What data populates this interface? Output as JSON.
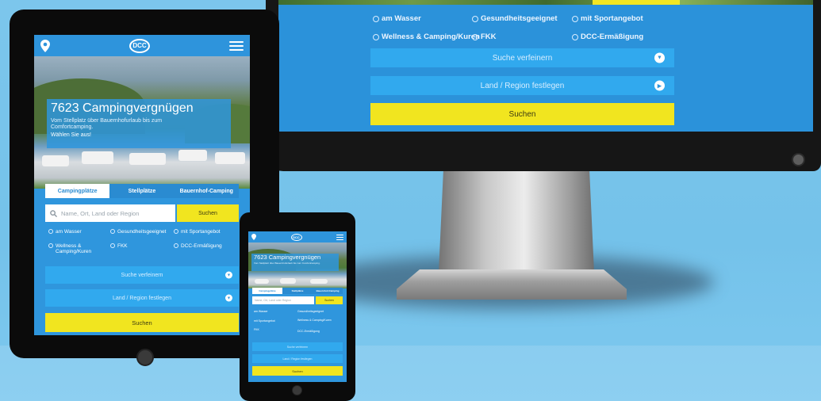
{
  "brand": {
    "logo_text": "DCC"
  },
  "hero": {
    "title": "7623 Campingvergnügen",
    "subtitle": "Vom Stellplatz über Bauernhofurlaub bis zum Comfortcamping.",
    "cta": "Wählen Sie aus!"
  },
  "tabs": [
    "Campingplätze",
    "Stellplätze",
    "Bauernhof-Camping"
  ],
  "search": {
    "placeholder": "Name, Ort, Land oder Region",
    "button_label": "Suchen"
  },
  "filters": {
    "am_wasser": "am Wasser",
    "geeignet": "Gesundheitsgeeignet",
    "sport": "mit Sportangebot",
    "wellness": "Wellness & Camping/Kuren",
    "fkk": "FKK",
    "dcc": "DCC-Ermäßigung"
  },
  "dropdowns": {
    "more": "Suche verfeinern",
    "country": "Land / Region festlegen"
  },
  "submit_label": "Suchen",
  "colors": {
    "primary": "#2f96dd",
    "accent": "#f1e51f"
  }
}
